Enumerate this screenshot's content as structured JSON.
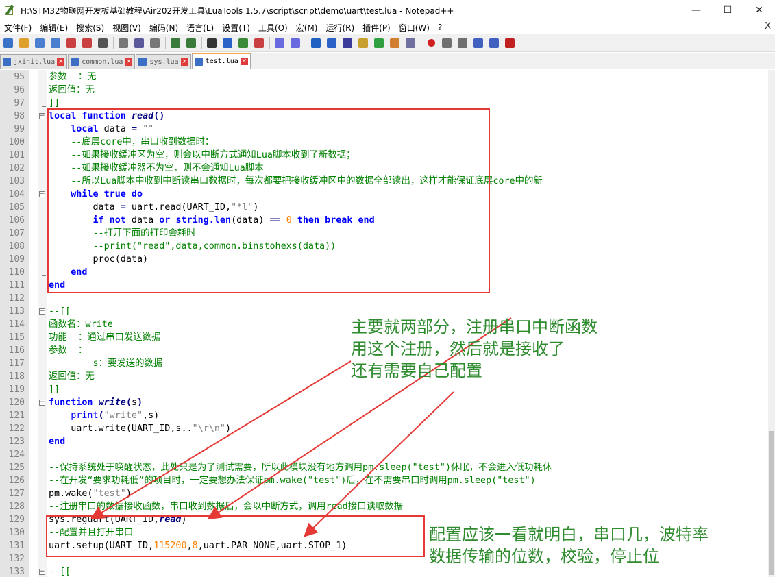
{
  "window": {
    "title": "H:\\STM32物联网开发板基础教程\\Air202开发工具\\LuaTools 1.5.7\\script\\script\\demo\\uart\\test.lua - Notepad++",
    "minimize": "—",
    "maximize": "☐",
    "close": "✕"
  },
  "menu": [
    "文件(F)",
    "编辑(E)",
    "搜索(S)",
    "视图(V)",
    "编码(N)",
    "语言(L)",
    "设置(T)",
    "工具(O)",
    "宏(M)",
    "运行(R)",
    "插件(P)",
    "窗口(W)",
    "?"
  ],
  "menu_close": "X",
  "toolbar_icons": [
    "new-file-icon",
    "open-file-icon",
    "save-icon",
    "save-all-icon",
    "close-icon",
    "close-all-icon",
    "print-icon",
    "cut-icon",
    "copy-icon",
    "paste-icon",
    "undo-icon",
    "redo-icon",
    "find-icon",
    "replace-icon",
    "zoom-in-icon",
    "zoom-out-icon",
    "sync-v-icon",
    "sync-h-icon",
    "word-wrap-icon",
    "show-all-chars-icon",
    "indent-guide-icon",
    "doc-map-icon",
    "function-list-icon",
    "folder-workspace-icon",
    "monitor-icon",
    "record-macro-icon",
    "stop-macro-icon",
    "play-macro-icon",
    "run-macro-multiple-icon",
    "save-macro-icon",
    "spell-check-icon"
  ],
  "tabs": [
    {
      "label": "jxinit.lua",
      "active": false
    },
    {
      "label": "common.lua",
      "active": false
    },
    {
      "label": "sys.lua",
      "active": false
    },
    {
      "label": "test.lua",
      "active": true
    }
  ],
  "lines": [
    {
      "n": "95",
      "t": [
        [
          "cm",
          "参数  ：无"
        ]
      ]
    },
    {
      "n": "96",
      "t": [
        [
          "cm",
          "返回值：无"
        ]
      ]
    },
    {
      "n": "97",
      "t": [
        [
          "cm",
          "]]"
        ]
      ]
    },
    {
      "n": "98",
      "t": [
        [
          "kw",
          "local function "
        ],
        [
          "fn",
          "read"
        ],
        [
          "op",
          "()"
        ]
      ]
    },
    {
      "n": "99",
      "t": [
        [
          "tx",
          "    "
        ],
        [
          "kw",
          "local"
        ],
        [
          "tx",
          " data "
        ],
        [
          "op",
          "="
        ],
        [
          "tx",
          " "
        ],
        [
          "str",
          "\"\""
        ]
      ]
    },
    {
      "n": "100",
      "t": [
        [
          "cm",
          "    --底层core中，串口收到数据时："
        ]
      ]
    },
    {
      "n": "101",
      "t": [
        [
          "cm",
          "    --如果接收缓冲区为空，则会以中断方式通知Lua脚本收到了新数据；"
        ]
      ]
    },
    {
      "n": "102",
      "t": [
        [
          "cm",
          "    --如果接收缓冲器不为空，则不会通知Lua脚本"
        ]
      ]
    },
    {
      "n": "103",
      "t": [
        [
          "cm",
          "    --所以Lua脚本中收到中断读串口数据时，每次都要把接收缓冲区中的数据全部读出，这样才能保证底层core中的新"
        ]
      ]
    },
    {
      "n": "104",
      "t": [
        [
          "tx",
          "    "
        ],
        [
          "kw",
          "while true do"
        ]
      ]
    },
    {
      "n": "105",
      "t": [
        [
          "tx",
          "        data "
        ],
        [
          "op",
          "="
        ],
        [
          "tx",
          " uart.read(UART_ID,"
        ],
        [
          "str",
          "\"*l\""
        ],
        [
          "tx",
          ")"
        ]
      ]
    },
    {
      "n": "106",
      "t": [
        [
          "tx",
          "        "
        ],
        [
          "kw",
          "if not"
        ],
        [
          "tx",
          " data "
        ],
        [
          "kw",
          "or"
        ],
        [
          "tx",
          " "
        ],
        [
          "kw",
          "string.len"
        ],
        [
          "tx",
          "(data) "
        ],
        [
          "op",
          "=="
        ],
        [
          "tx",
          " "
        ],
        [
          "num",
          "0"
        ],
        [
          "tx",
          " "
        ],
        [
          "kw",
          "then break end"
        ]
      ]
    },
    {
      "n": "107",
      "t": [
        [
          "cm",
          "        --打开下面的打印会耗时"
        ]
      ]
    },
    {
      "n": "108",
      "t": [
        [
          "cm",
          "        --print(\"read\",data,common.binstohexs(data))"
        ]
      ]
    },
    {
      "n": "109",
      "t": [
        [
          "tx",
          "        proc(data)"
        ]
      ]
    },
    {
      "n": "110",
      "t": [
        [
          "tx",
          "    "
        ],
        [
          "kw",
          "end"
        ]
      ]
    },
    {
      "n": "111",
      "t": [
        [
          "kw",
          "end"
        ]
      ]
    },
    {
      "n": "112",
      "t": []
    },
    {
      "n": "113",
      "t": [
        [
          "cm",
          "--[["
        ]
      ]
    },
    {
      "n": "114",
      "t": [
        [
          "cm",
          "函数名：write"
        ]
      ]
    },
    {
      "n": "115",
      "t": [
        [
          "cm",
          "功能  ：通过串口发送数据"
        ]
      ]
    },
    {
      "n": "116",
      "t": [
        [
          "cm",
          "参数  ："
        ]
      ]
    },
    {
      "n": "117",
      "t": [
        [
          "cm",
          "        s：要发送的数据"
        ]
      ]
    },
    {
      "n": "118",
      "t": [
        [
          "cm",
          "返回值：无"
        ]
      ]
    },
    {
      "n": "119",
      "t": [
        [
          "cm",
          "]]"
        ]
      ]
    },
    {
      "n": "120",
      "t": [
        [
          "kw",
          "function "
        ],
        [
          "fn",
          "write"
        ],
        [
          "op",
          "("
        ],
        [
          "tx",
          "s"
        ],
        [
          "op",
          ")"
        ]
      ]
    },
    {
      "n": "121",
      "t": [
        [
          "tx",
          "    "
        ],
        [
          "lib",
          "print"
        ],
        [
          "op",
          "("
        ],
        [
          "str",
          "\"write\""
        ],
        [
          "tx",
          ",s)"
        ]
      ]
    },
    {
      "n": "122",
      "t": [
        [
          "tx",
          "    uart.write(UART_ID,s.."
        ],
        [
          "str",
          "\"\\r\\n\""
        ],
        [
          "tx",
          ")"
        ]
      ]
    },
    {
      "n": "123",
      "t": [
        [
          "kw",
          "end"
        ]
      ]
    },
    {
      "n": "124",
      "t": []
    },
    {
      "n": "125",
      "t": [
        [
          "cm",
          "--保持系统处于唤醒状态，此处只是为了测试需要，所以此模块没有地方调用pm.sleep(\"test\")休眠，不会进入低功耗休"
        ]
      ]
    },
    {
      "n": "126",
      "t": [
        [
          "cm",
          "--在开发“要求功耗低”的项目时，一定要想办法保证pm.wake(\"test\")后，在不需要串口时调用pm.sleep(\"test\")"
        ]
      ]
    },
    {
      "n": "127",
      "t": [
        [
          "tx",
          "pm.wake("
        ],
        [
          "str",
          "\"test\""
        ],
        [
          "tx",
          ")"
        ]
      ]
    },
    {
      "n": "128",
      "t": [
        [
          "cm",
          "--注册串口的数据接收函数，串口收到数据后，会以中断方式，调用read接口读取数据"
        ]
      ]
    },
    {
      "n": "129",
      "t": [
        [
          "tx",
          "sys.reguart(UART_ID,"
        ],
        [
          "fn",
          "read"
        ],
        [
          "tx",
          ")"
        ]
      ]
    },
    {
      "n": "130",
      "t": [
        [
          "cm",
          "--配置并且打开串口"
        ]
      ]
    },
    {
      "n": "131",
      "t": [
        [
          "tx",
          "uart.setup(UART_ID,"
        ],
        [
          "num",
          "115200"
        ],
        [
          "tx",
          ","
        ],
        [
          "num",
          "8"
        ],
        [
          "tx",
          ",uart.PAR_NONE,uart.STOP_1)"
        ]
      ]
    },
    {
      "n": "132",
      "t": []
    },
    {
      "n": "133",
      "t": [
        [
          "cm",
          "--[["
        ]
      ]
    }
  ],
  "annotations": {
    "note1": [
      "主要就两部分，注册串口中断函数",
      "用这个注册，然后就是接收了",
      "还有需要自己配置"
    ],
    "note2": [
      "配置应该一看就明白，串口几，波特率",
      "数据传输的位数，校验，停止位"
    ],
    "box_color": "#e53935",
    "note_color": "#2e8b2e"
  }
}
